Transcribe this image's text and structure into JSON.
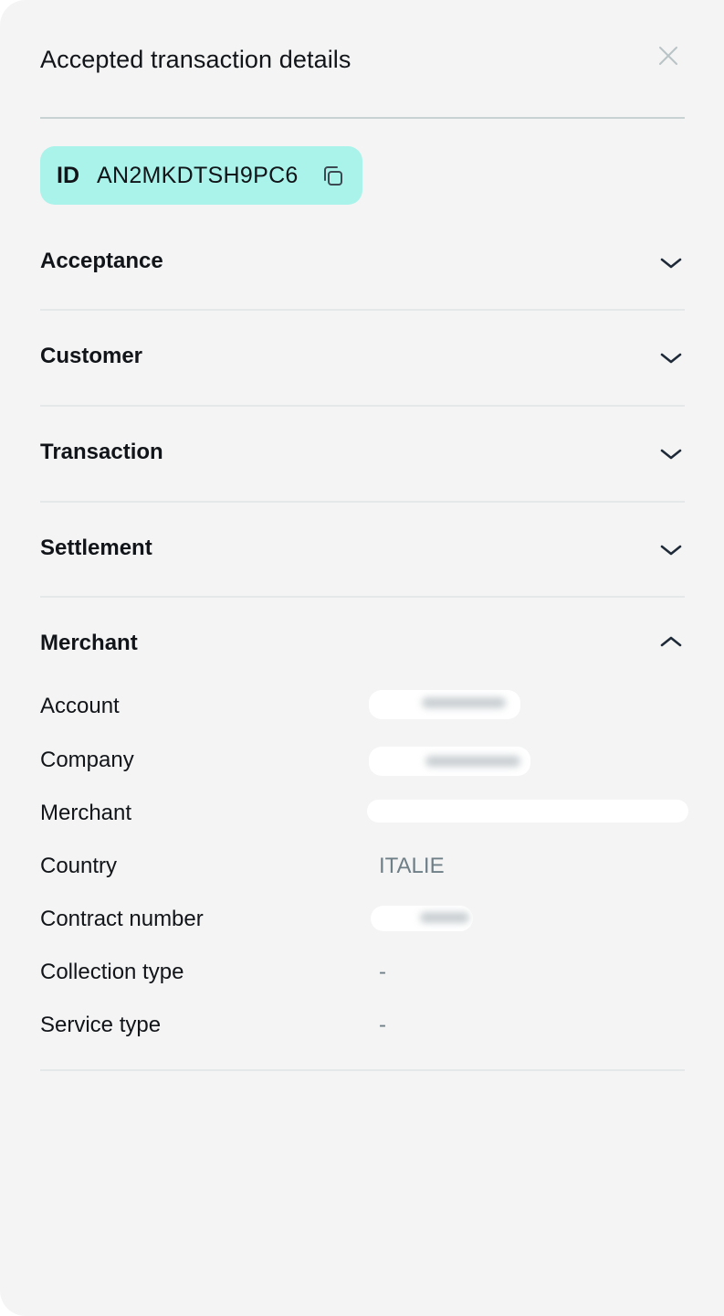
{
  "panel": {
    "title": "Accepted transaction details",
    "close_icon": "close-icon"
  },
  "id_chip": {
    "label": "ID",
    "value": "AN2MKDTSH9PC6",
    "copy_icon": "copy-icon",
    "background": "#a9f3ea"
  },
  "sections": [
    {
      "title": "Acceptance",
      "expanded": false
    },
    {
      "title": "Customer",
      "expanded": false
    },
    {
      "title": "Transaction",
      "expanded": false
    },
    {
      "title": "Settlement",
      "expanded": false
    },
    {
      "title": "Merchant",
      "expanded": true
    }
  ],
  "merchant": {
    "rows": [
      {
        "label": "Account",
        "value": "",
        "redacted": true
      },
      {
        "label": "Company",
        "value": "",
        "redacted": true
      },
      {
        "label": "Merchant",
        "value": "",
        "redacted": true
      },
      {
        "label": "Country",
        "value": "ITALIE",
        "redacted": false
      },
      {
        "label": "Contract number",
        "value": "",
        "redacted": true
      },
      {
        "label": "Collection type",
        "value": "-",
        "redacted": false
      },
      {
        "label": "Service type",
        "value": "-",
        "redacted": false
      }
    ]
  },
  "colors": {
    "panel_bg": "#f4f4f4",
    "text": "#111418",
    "muted_value": "#6f7f88",
    "chevron": "#1f2a38",
    "divider": "#e5e8e8"
  }
}
